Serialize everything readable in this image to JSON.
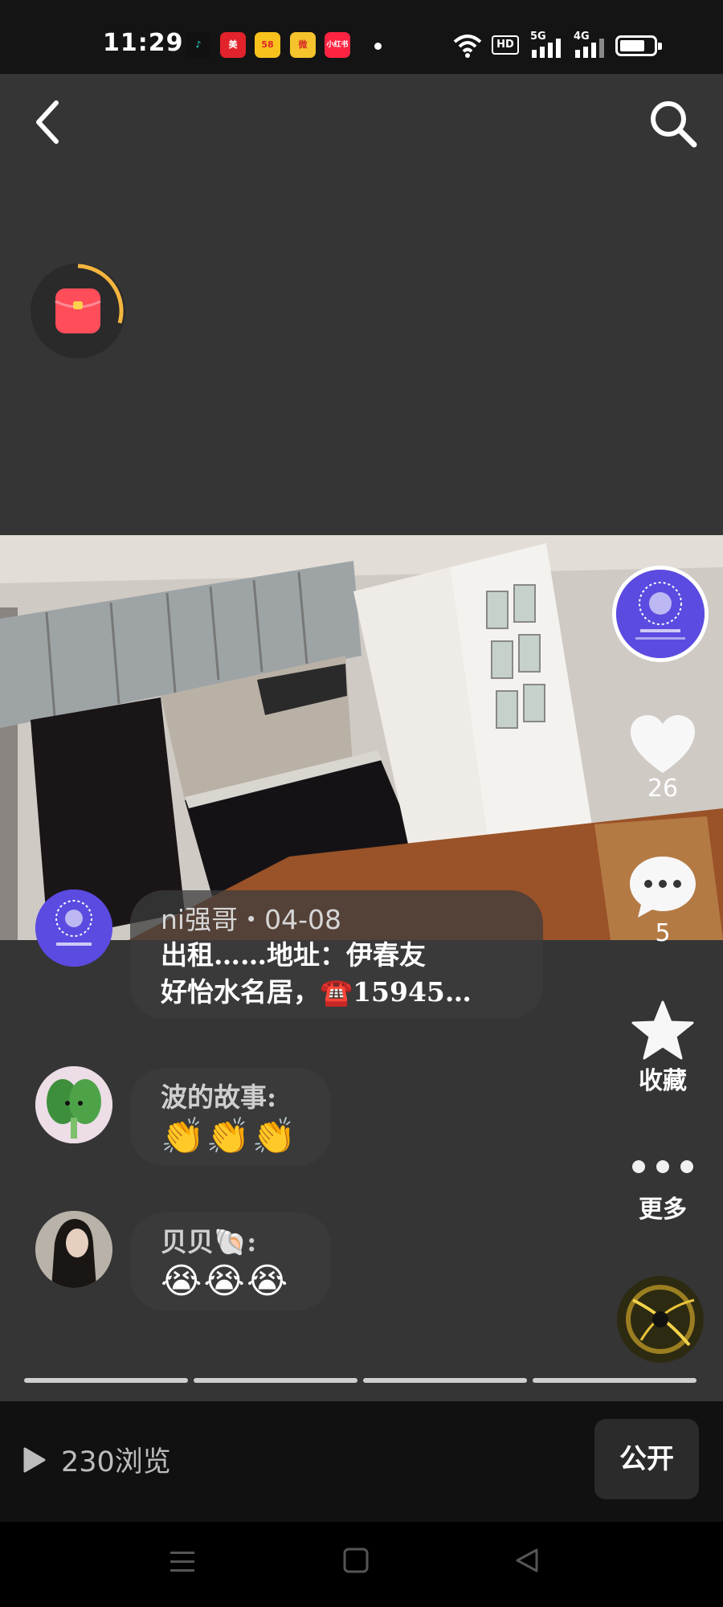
{
  "status_bar": {
    "time": "11:29",
    "app_icons": [
      {
        "name": "tiktok-icon",
        "color": "#111111",
        "glyph": "♪"
      },
      {
        "name": "meituan-icon",
        "color": "#e2232b",
        "glyph": "美"
      },
      {
        "name": "58-icon",
        "color": "#f8c11c",
        "glyph": "58"
      },
      {
        "name": "weibo-icon",
        "color": "#f5c32c",
        "glyph": "微"
      },
      {
        "name": "xiaohongshu-icon",
        "color": "#ff2442",
        "glyph": "小红书"
      }
    ],
    "hd_label": "HD",
    "net1_label": "5G",
    "net2_label": "4G"
  },
  "post": {
    "views_label": "230浏览",
    "visibility_button": "公开"
  },
  "side_actions": {
    "like_count": "26",
    "comment_count": "5",
    "favorite_label": "收藏",
    "more_label": "更多"
  },
  "comments": [
    {
      "name": "ni强哥・04-08",
      "text_line1": "出租……地址：伊春友",
      "text_line2": "好怡水名居，☎️15945…"
    },
    {
      "name": "波的故事:",
      "text": "👏👏👏"
    },
    {
      "name": "贝贝🐚:",
      "text": "😭😭😭"
    }
  ],
  "colors": {
    "background": "#353535",
    "accent_purple": "#5b4be0",
    "redpacket": "#ff4d5a"
  }
}
